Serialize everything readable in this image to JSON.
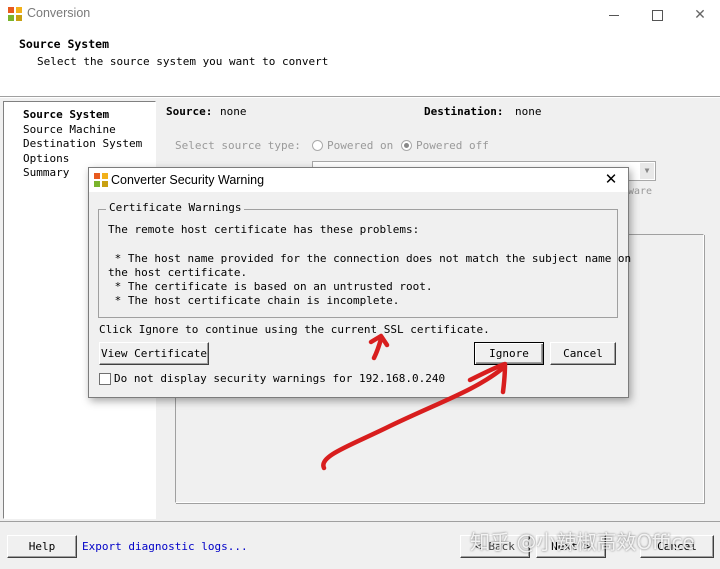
{
  "window": {
    "title": "Conversion"
  },
  "header": {
    "title": "Source System",
    "subtitle": "Select the source system you want to convert"
  },
  "sidebar": {
    "items": [
      {
        "label": "Source System",
        "active": true
      },
      {
        "label": "Source Machine",
        "active": false
      },
      {
        "label": "Destination System",
        "active": false
      },
      {
        "label": "Options",
        "active": false
      },
      {
        "label": "Summary",
        "active": false
      }
    ]
  },
  "main": {
    "source_label": "Source:",
    "source_value": "none",
    "destination_label": "Destination:",
    "destination_value": "none",
    "source_type_label": "Select source type:",
    "radio_powered_on": "Powered on",
    "radio_powered_off": "Powered off",
    "selected_radio": "Powered off",
    "combo_tail_text": "ware"
  },
  "dialog": {
    "title": "Converter Security Warning",
    "group_label": "Certificate Warnings",
    "intro": "The remote host certificate has these problems:",
    "problems": [
      " * The host name provided for the connection does not match the subject name on",
      "the host certificate.",
      " * The certificate is based on an untrusted root.",
      " * The host certificate chain is incomplete."
    ],
    "ignore_message": "Click Ignore to continue using the current SSL certificate.",
    "view_certificate_label": "View Certificate",
    "ignore_label": "Ignore",
    "cancel_label": "Cancel",
    "checkbox_label": "Do not display security warnings for 192.168.0.240",
    "checkbox_checked": false
  },
  "footer": {
    "help_label": "Help",
    "export_link": "Export diagnostic logs...",
    "back_label": "< Back",
    "next_label": "Next >",
    "cancel_label": "Cancel"
  },
  "watermark": "知乎 @小辣椒高效Office",
  "colors": {
    "link": "#0000c8",
    "annotation_red": "#d81e1e",
    "window_bg": "#f0f0f0"
  }
}
